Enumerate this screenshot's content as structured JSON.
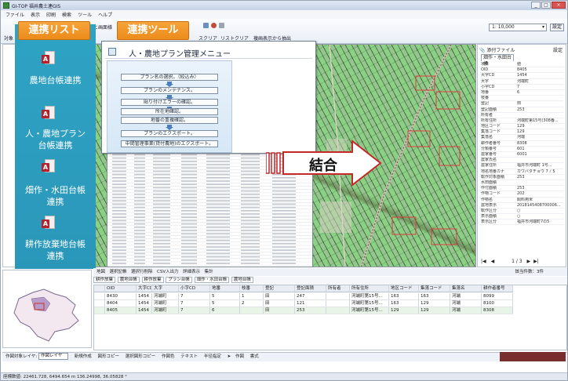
{
  "window": {
    "title": "GI-TOP 福井農土連GIS",
    "buttons": [
      "_",
      "□",
      "×"
    ]
  },
  "menu": [
    "ファイル",
    "表示",
    "印刷",
    "検索",
    "ツール",
    "ヘルプ"
  ],
  "toolbar": {
    "left_label": "対象",
    "image_label": "と画面様",
    "screen_clear": "スクリア",
    "list_clear": "リストクリア",
    "extract": "複画表示から抽出",
    "scale_value": "1: 10,000",
    "settei": "設定"
  },
  "strip": {
    "header": "連携リスト",
    "items": [
      "農地台帳連携",
      "人・農地プラン台帳連携",
      "畑作・水田台帳連携",
      "耕作放棄地台帳連携"
    ],
    "item_lines": [
      [
        "農地台帳連携"
      ],
      [
        "人・農地プラン",
        "台帳連携"
      ],
      [
        "畑作・水田台帳",
        "連携"
      ],
      [
        "耕作放棄地台帳",
        "連携"
      ]
    ],
    "accent": "#2fa3c4"
  },
  "tool_header": "連携ツール",
  "menu_window": {
    "title": "人・農地プラン管理メニュー",
    "buttons": [
      "プラン名の選択。（絞込み）",
      "プランのメンテナンス。",
      "貼り付けエラーの確認。",
      "所在地確認。",
      "地番の重複確認。",
      "プランのエクスポート。",
      "中間管理事業(貸付農地)のエクスポート。"
    ]
  },
  "merge_label": "結合",
  "right_panel": {
    "header": "添付ファイル",
    "settei": "設定",
    "tab": "畑作・水田台帳",
    "rows": [
      [
        "項目",
        "値"
      ],
      [
        "OID",
        "8405"
      ],
      [
        "大字CD",
        "1454"
      ],
      [
        "大字",
        "河端町"
      ],
      [
        "小字CD",
        "7"
      ],
      [
        "地番",
        "6"
      ],
      [
        "枝番",
        ""
      ],
      [
        "登記",
        "田"
      ],
      [
        "登記面積",
        "253"
      ],
      [
        "所有者",
        ""
      ],
      [
        "所有住所",
        "河端町第15号(308番..."
      ],
      [
        "地区コード",
        "129"
      ],
      [
        "集落コード",
        "129"
      ],
      [
        "集落名",
        "河端"
      ],
      [
        "耕作者番号",
        "8308"
      ],
      [
        "分類番号",
        "601"
      ],
      [
        "農家番号",
        "6001"
      ],
      [
        "農家氏名",
        ""
      ],
      [
        "農家住所",
        "福井市河端町 1号..."
      ],
      [
        "地名地番カナ",
        "カワバタチョウ 7 ﾉ 5"
      ],
      [
        "転作対象面積",
        "253"
      ],
      [
        "水田面積",
        ""
      ],
      [
        "作付面積",
        "253"
      ],
      [
        "作物コード",
        "202"
      ],
      [
        "作物名",
        "飼料用米"
      ],
      [
        "農地表示",
        "2018145408700006..."
      ],
      [
        "転作区分",
        "○"
      ],
      [
        "表示面積",
        "○"
      ],
      [
        "表示区分",
        "福井市河端町7の5"
      ]
    ],
    "pager": "1 / 3"
  },
  "bottom_toolbar": "地図　選択記帳　選択行削除　CSV入出力　詳細表示　集計",
  "bottom_count": "該当件数：3件",
  "bottom_tabs": [
    "耕作放棄",
    "農地台帳",
    "耕作放棄",
    "プラン台帳",
    "畑作・水田台帳",
    "農地台帳"
  ],
  "grid": {
    "headers": [
      "OID",
      "大字CD",
      "大字",
      "小字CD",
      "地番",
      "枝番",
      "登記",
      "登記面積",
      "所有者",
      "所有住所",
      "地区コード",
      "集落コード",
      "集落名",
      "耕作者番号"
    ],
    "rows": [
      [
        "8430",
        "1454",
        "河端町",
        "7",
        "5",
        "1",
        "田",
        "247",
        "",
        "河端町第15号...",
        "163",
        "163",
        "河端",
        "8099"
      ],
      [
        "8404",
        "1454",
        "河端町",
        "7",
        "5",
        "2",
        "田",
        "121",
        "",
        "河端町第15号...",
        "163",
        "129",
        "河端",
        "8100"
      ],
      [
        "8405",
        "1454",
        "河端町",
        "7",
        "6",
        "",
        "田",
        "253",
        "",
        "河端町第15号...",
        "129",
        "129",
        "河端",
        "8308"
      ]
    ]
  },
  "layer_bar": {
    "label": "作図対象レイヤ:",
    "value": "作図レイヤ",
    "tools": [
      "新規作成",
      "図形コピー",
      "選択図形コピー",
      "作図色",
      "テキスト",
      "半径指定",
      "作図",
      "書式"
    ]
  },
  "status": "座標数値: 22461.728, 6494.654 m   136.24998, 36.05828 °"
}
